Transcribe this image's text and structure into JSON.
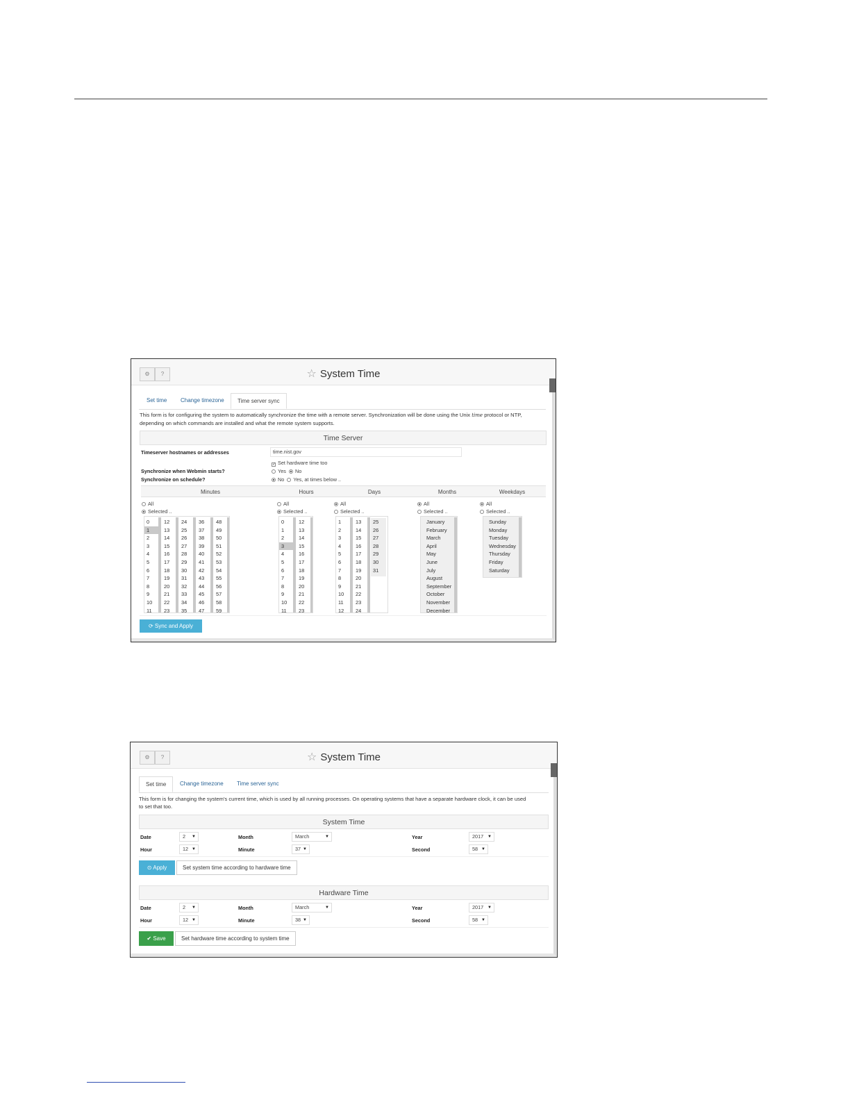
{
  "top_screenshot": {
    "title": "System Time",
    "tabs": [
      "Set time",
      "Change timezone",
      "Time server sync"
    ],
    "active_tab": "Time server sync",
    "description_1": "This form is for configuring the system to automatically synchronize the time with a remote server. Synchronization will be done using the Unix",
    "description_code": "time",
    "description_2": "protocol or NTP,",
    "description_3": "depending on which commands are installed and what the remote system supports.",
    "panel_title": "Time Server",
    "hostname_label": "Timeserver hostnames or addresses",
    "hostname_value": "time.nist.gov",
    "hw_checkbox_label": "Set hardware time too",
    "sync_start_label": "Synchronize when Webmin starts?",
    "sync_start_yes": "Yes",
    "sync_start_no": "No",
    "sync_sched_label": "Synchronize on schedule?",
    "sync_sched_no": "No",
    "sync_sched_yes": "Yes, at times below ..",
    "col_minutes": "Minutes",
    "col_hours": "Hours",
    "col_days": "Days",
    "col_months": "Months",
    "col_weekdays": "Weekdays",
    "opt_all": "All",
    "opt_selected": "Selected ..",
    "minutes_cols": [
      [
        "0",
        "1",
        "2",
        "3",
        "4",
        "5",
        "6",
        "7",
        "8",
        "9",
        "10",
        "11"
      ],
      [
        "12",
        "13",
        "14",
        "15",
        "16",
        "17",
        "18",
        "19",
        "20",
        "21",
        "22",
        "23"
      ],
      [
        "24",
        "25",
        "26",
        "27",
        "28",
        "29",
        "30",
        "31",
        "32",
        "33",
        "34",
        "35"
      ],
      [
        "36",
        "37",
        "38",
        "39",
        "40",
        "41",
        "42",
        "43",
        "44",
        "45",
        "46",
        "47"
      ],
      [
        "48",
        "49",
        "50",
        "51",
        "52",
        "53",
        "54",
        "55",
        "56",
        "57",
        "58",
        "59"
      ]
    ],
    "hours_cols": [
      [
        "0",
        "1",
        "2",
        "3",
        "4",
        "5",
        "6",
        "7",
        "8",
        "9",
        "10",
        "11"
      ],
      [
        "12",
        "13",
        "14",
        "15",
        "16",
        "17",
        "18",
        "19",
        "20",
        "21",
        "22",
        "23"
      ]
    ],
    "days_cols": [
      [
        "1",
        "2",
        "3",
        "4",
        "5",
        "6",
        "7",
        "8",
        "9",
        "10",
        "11",
        "12"
      ],
      [
        "13",
        "14",
        "15",
        "16",
        "17",
        "18",
        "19",
        "20",
        "21",
        "22",
        "23",
        "24"
      ],
      [
        "25",
        "26",
        "27",
        "28",
        "29",
        "30",
        "31"
      ]
    ],
    "months": [
      "January",
      "February",
      "March",
      "April",
      "May",
      "June",
      "July",
      "August",
      "September",
      "October",
      "November",
      "December"
    ],
    "weekdays": [
      "Sunday",
      "Monday",
      "Tuesday",
      "Wednesday",
      "Thursday",
      "Friday",
      "Saturday"
    ],
    "sync_button": "Sync and Apply"
  },
  "bottom_screenshot": {
    "title": "System Time",
    "tabs": [
      "Set time",
      "Change timezone",
      "Time server sync"
    ],
    "active_tab": "Set time",
    "description_1": "This form is for changing the system's current time, which is used by all running processes. On operating systems that have a separate hardware clock, it can be used",
    "description_2": "to set that too.",
    "system_panel": {
      "title": "System Time",
      "date_label": "Date",
      "date_value": "2",
      "month_label": "Month",
      "month_value": "March",
      "year_label": "Year",
      "year_value": "2017",
      "hour_label": "Hour",
      "hour_value": "12",
      "minute_label": "Minute",
      "minute_value": "37",
      "second_label": "Second",
      "second_value": "58"
    },
    "apply_button": "Apply",
    "set_from_hw_button": "Set system time according to hardware time",
    "hardware_panel": {
      "title": "Hardware Time",
      "date_label": "Date",
      "date_value": "2",
      "month_label": "Month",
      "month_value": "March",
      "year_label": "Year",
      "year_value": "2017",
      "hour_label": "Hour",
      "hour_value": "12",
      "minute_label": "Minute",
      "minute_value": "38",
      "second_label": "Second",
      "second_value": "58"
    },
    "save_button": "Save",
    "set_from_sys_button": "Set hardware time according to system time"
  }
}
